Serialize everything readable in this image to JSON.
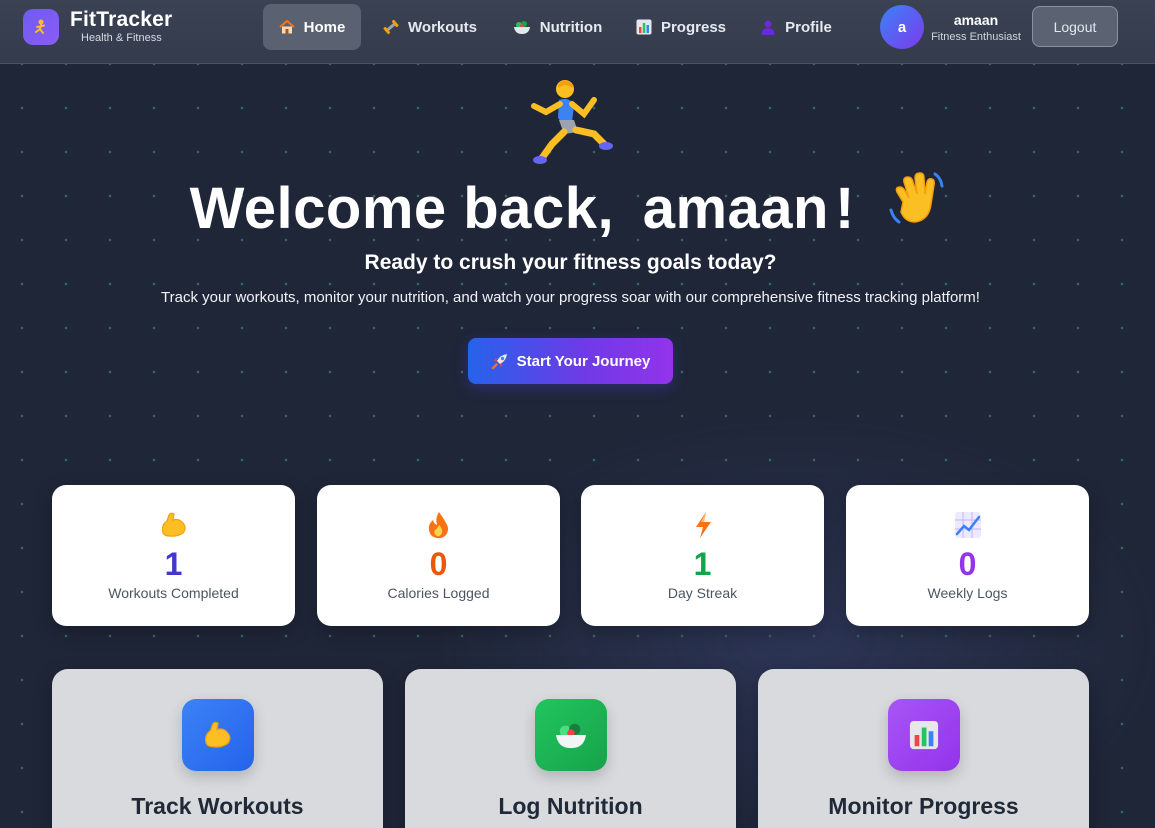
{
  "app": {
    "name": "FitTracker",
    "tagline": "Health & Fitness",
    "logo_icon": "runner-logo-icon"
  },
  "nav": {
    "items": [
      {
        "label": "Home",
        "icon": "house-icon",
        "active": true
      },
      {
        "label": "Workouts",
        "icon": "dumbbell-icon",
        "active": false
      },
      {
        "label": "Nutrition",
        "icon": "salad-bowl-icon",
        "active": false
      },
      {
        "label": "Progress",
        "icon": "bar-chart-icon",
        "active": false
      },
      {
        "label": "Profile",
        "icon": "person-icon",
        "active": false
      }
    ]
  },
  "user": {
    "initial": "a",
    "name": "amaan",
    "role": "Fitness Enthusiast",
    "logout_label": "Logout"
  },
  "hero": {
    "icon": "running-person-icon",
    "welcome_prefix": "Welcome back,",
    "user_name": "amaan",
    "exclamation": "!",
    "wave_icon": "waving-hand-icon",
    "subtitle": "Ready to crush your fitness goals today?",
    "description": "Track your workouts, monitor your nutrition, and watch your progress soar with our comprehensive fitness tracking platform!",
    "cta_label": "Start Your Journey",
    "cta_icon": "rocket-icon"
  },
  "stats": [
    {
      "icon": "flexed-biceps-icon",
      "value": "1",
      "label": "Workouts Completed",
      "color": "#4338ca"
    },
    {
      "icon": "fire-icon",
      "value": "0",
      "label": "Calories Logged",
      "color": "#ea580c"
    },
    {
      "icon": "lightning-icon",
      "value": "1",
      "label": "Day Streak",
      "color": "#16a34a"
    },
    {
      "icon": "trend-chart-icon",
      "value": "0",
      "label": "Weekly Logs",
      "color": "#9333ea"
    }
  ],
  "features": [
    {
      "title": "Track Workouts",
      "icon": "flexed-biceps-icon",
      "color": "#3b82f6"
    },
    {
      "title": "Log Nutrition",
      "icon": "salad-bowl-icon",
      "color": "#16a34a"
    },
    {
      "title": "Monitor Progress",
      "icon": "bar-chart-icon",
      "color": "#9333ea"
    }
  ],
  "colors": {
    "background": "#1f2638",
    "navbar": "#3b4253",
    "accent_gradient_start": "#2563eb",
    "accent_gradient_end": "#9333ea"
  }
}
